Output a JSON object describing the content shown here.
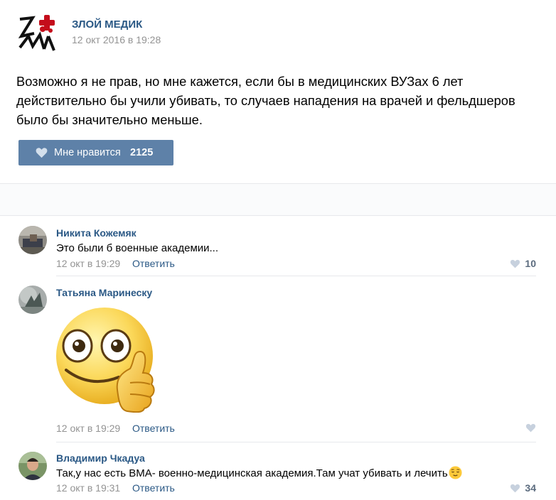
{
  "post": {
    "author": "ЗЛОЙ МЕДИК",
    "date": "12 окт 2016 в 19:28",
    "text_lines": [
      "Возможно я не прав, но мне кажется, если бы в медицинских ВУЗах 6 лет",
      "действительно бы учили убивать, то случаев нападения на врачей и фельдшеров",
      "было бы значительно меньше."
    ],
    "like_label": "Мне нравится",
    "like_count": "2125"
  },
  "comments": [
    {
      "name": "Никита Кожемяк",
      "text": "Это были б военные академии...",
      "date": "12 окт в 19:29",
      "reply": "Ответить",
      "likes": "10"
    },
    {
      "name": "Татьяна Маринеску",
      "sticker": "thumbs-up-smiley-sticker",
      "date": "12 окт в 19:29",
      "reply": "Ответить",
      "likes": ""
    },
    {
      "name": "Владимир Чкадуа",
      "text": "Так,у нас есть ВМА- военно-медицинская академия.Там учат убивать и лечить",
      "emoji": "relieved-face-emoji",
      "date": "12 окт в 19:31",
      "reply": "Ответить",
      "likes": "34"
    }
  ],
  "colors": {
    "link": "#2a5885",
    "muted": "#939393",
    "like_button": "#5e81a8",
    "heart_inactive": "#c7d1de"
  }
}
